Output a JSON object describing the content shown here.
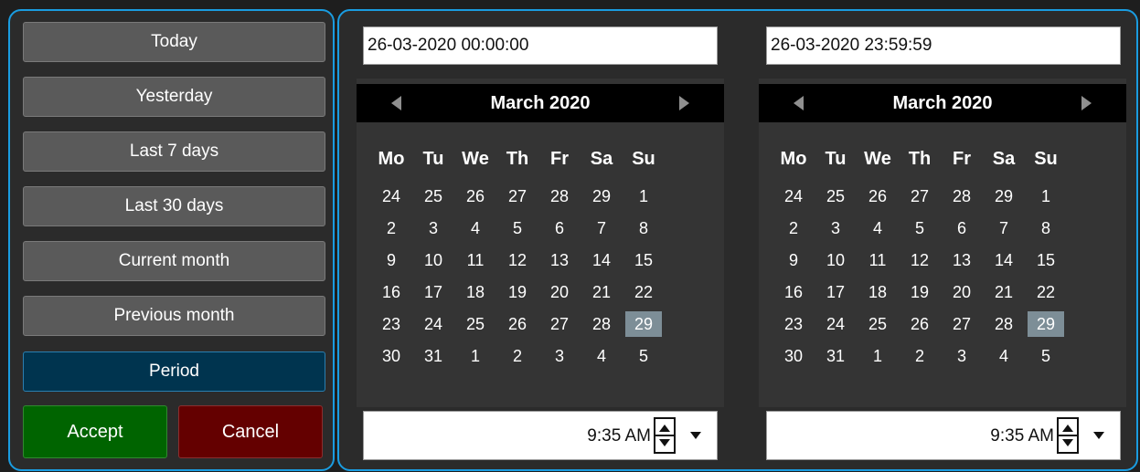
{
  "presets": {
    "today": "Today",
    "yesterday": "Yesterday",
    "last7": "Last 7 days",
    "last30": "Last 30 days",
    "current_month": "Current month",
    "previous_month": "Previous month",
    "period": "Period"
  },
  "actions": {
    "accept": "Accept",
    "cancel": "Cancel"
  },
  "colors": {
    "panel_border": "#1a9ce0",
    "accept_bg": "#006400",
    "cancel_bg": "#640000",
    "period_active_bg": "#00344f",
    "selected_day_bg": "#7d8e97"
  },
  "calendar_weekdays": [
    "Mo",
    "Tu",
    "We",
    "Th",
    "Fr",
    "Sa",
    "Su"
  ],
  "calendar_days": [
    [
      "24",
      "25",
      "26",
      "27",
      "28",
      "29",
      "1"
    ],
    [
      "2",
      "3",
      "4",
      "5",
      "6",
      "7",
      "8"
    ],
    [
      "9",
      "10",
      "11",
      "12",
      "13",
      "14",
      "15"
    ],
    [
      "16",
      "17",
      "18",
      "19",
      "20",
      "21",
      "22"
    ],
    [
      "23",
      "24",
      "25",
      "26",
      "27",
      "28",
      "29"
    ],
    [
      "30",
      "31",
      "1",
      "2",
      "3",
      "4",
      "5"
    ]
  ],
  "from": {
    "date_value": "26-03-2020 00:00:00",
    "month_label": "March 2020",
    "selected_day": "29",
    "time_value": "9:35 AM"
  },
  "to": {
    "date_value": "26-03-2020 23:59:59",
    "month_label": "March 2020",
    "selected_day": "29",
    "time_value": "9:35 AM"
  },
  "icons": {
    "prev": "triangle-left-icon",
    "next": "triangle-right-icon",
    "spin": "up-down-spinner-icon",
    "dropdown": "chevron-down-icon"
  }
}
